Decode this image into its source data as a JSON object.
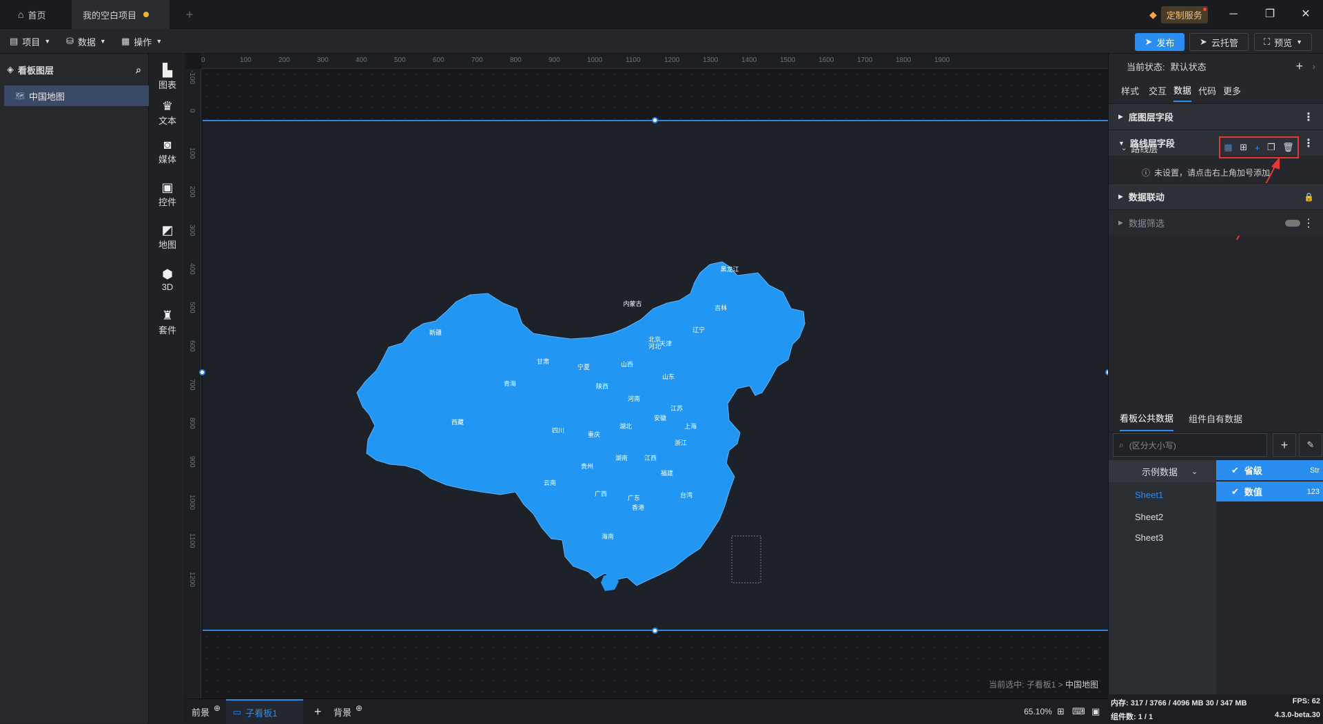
{
  "titlebar": {
    "home_tab": "首页",
    "project_tab": "我的空白项目",
    "new_tab": "+",
    "vip_label": "定制服务"
  },
  "menubar": {
    "project": "项目",
    "data": "数据",
    "operation": "操作",
    "publish": "发布",
    "cloud": "云托管",
    "preview": "预览"
  },
  "layers": {
    "title": "看板图层",
    "items": [
      {
        "label": "中国地图"
      }
    ]
  },
  "components": [
    {
      "label": "图表",
      "icon": "chart-icon"
    },
    {
      "label": "文本",
      "icon": "text-icon"
    },
    {
      "label": "媒体",
      "icon": "media-icon"
    },
    {
      "label": "控件",
      "icon": "control-icon"
    },
    {
      "label": "地图",
      "icon": "map-icon"
    },
    {
      "label": "3D",
      "icon": "cube-icon"
    },
    {
      "label": "套件",
      "icon": "kit-icon"
    }
  ],
  "ruler_top": [
    "0",
    "100",
    "200",
    "300",
    "400",
    "500",
    "600",
    "700",
    "800",
    "900",
    "1000",
    "1100",
    "1200",
    "1300",
    "1400",
    "1500",
    "1600",
    "1700",
    "1800",
    "1900"
  ],
  "ruler_left": [
    "-100",
    "0",
    "100",
    "200",
    "300",
    "400",
    "500",
    "600",
    "700",
    "800",
    "900",
    "1000",
    "1100",
    "1200"
  ],
  "map": {
    "provinces": [
      "黑龙江",
      "吉林",
      "辽宁",
      "内蒙古",
      "北京",
      "河北",
      "天津",
      "山西",
      "山东",
      "新疆",
      "甘肃",
      "宁夏",
      "陕西",
      "青海",
      "西藏",
      "河南",
      "江苏",
      "安徽",
      "上海",
      "湖北",
      "四川",
      "重庆",
      "浙江",
      "湖南",
      "江西",
      "贵州",
      "福建",
      "云南",
      "广西",
      "广东",
      "香港",
      "台湾",
      "海南"
    ]
  },
  "selection": {
    "prefix": "当前选中: 子看板1 > ",
    "current": "中国地图"
  },
  "bottombar": {
    "front": "前景",
    "subboard": "子看板1",
    "add": "+",
    "background": "背景",
    "zoom": "65.10%"
  },
  "rightpanel": {
    "state_label": "当前状态:",
    "state_value": "默认状态",
    "tabs": [
      "样式",
      "交互",
      "数据",
      "代码",
      "更多"
    ],
    "active_tab": "数据",
    "sections": {
      "base_fields": "底图层字段",
      "route_fields": "路线层字段",
      "route_layer": "路线层",
      "empty_hint": "未设置，请点击右上角加号添加",
      "linkage": "数据联动",
      "filter": "数据筛选"
    },
    "data_tabs": [
      "看板公共数据",
      "组件自有数据"
    ],
    "search_placeholder": "(区分大小写)",
    "dataset": "示例数据",
    "sheets": [
      "Sheet1",
      "Sheet2",
      "Sheet3"
    ],
    "fields": [
      {
        "name": "省级",
        "type": "Str"
      },
      {
        "name": "数值",
        "type": "123"
      }
    ]
  },
  "status": {
    "memory": "内存:  317 / 3766 / 4096 MB  30 / 347 MB",
    "fps": "FPS:  62",
    "components": "组件数: 1 / 1",
    "version": "4.3.0-beta.30"
  },
  "colors": {
    "accent": "#2a8ef0",
    "map_fill": "#2196f3",
    "highlight": "#e53935"
  }
}
